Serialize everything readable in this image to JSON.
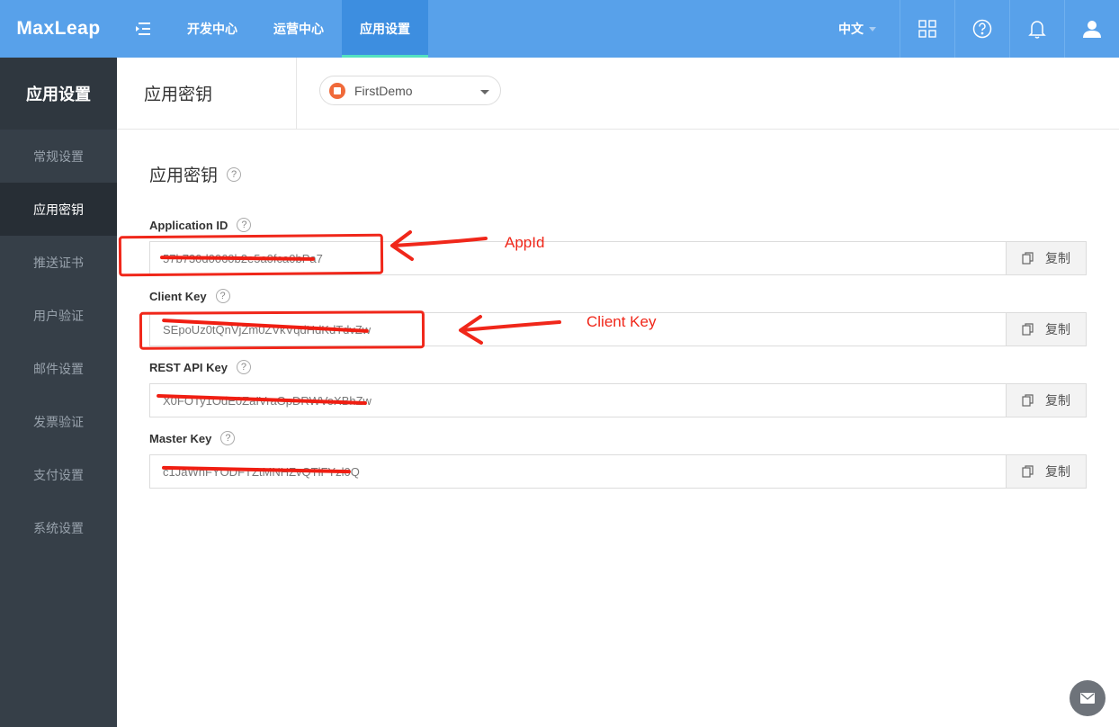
{
  "topbar": {
    "logo": "MaxLeap",
    "nav": [
      "开发中心",
      "运营中心",
      "应用设置"
    ],
    "active_nav": "应用设置",
    "language": "中文"
  },
  "sidebar": {
    "title": "应用设置",
    "items": [
      {
        "label": "常规设置"
      },
      {
        "label": "应用密钥"
      },
      {
        "label": "推送证书"
      },
      {
        "label": "用户验证"
      },
      {
        "label": "邮件设置"
      },
      {
        "label": "发票验证"
      },
      {
        "label": "支付设置"
      },
      {
        "label": "系统设置"
      }
    ],
    "active": "应用密钥"
  },
  "header": {
    "title": "应用密钥",
    "app_select": "FirstDemo"
  },
  "main": {
    "section_title": "应用密钥",
    "help_glyph": "?",
    "copy_label": "复制",
    "fields": [
      {
        "label": "Application ID",
        "value": "57b730d0060b2e5a0fca0bPa7"
      },
      {
        "label": "Client Key",
        "value": "SEpoUz0tQnVjZm0ZVkVqdHdKdTdvZw"
      },
      {
        "label": "REST API Key",
        "value": "X0FOTy1OdE0ZaIVraGpDRWVoXBhZw"
      },
      {
        "label": "Master Key",
        "value": "c1JaWnFYODFTZtMNHZvQTlFYzl0Q"
      }
    ]
  },
  "annotations": {
    "appid_label": "AppId",
    "clientkey_label": "Client Key",
    "color": "#f0271a"
  },
  "colors": {
    "topbar": "#58a1ea",
    "sidebar": "#363f48",
    "active_tab_underline": "#54e1c0"
  }
}
